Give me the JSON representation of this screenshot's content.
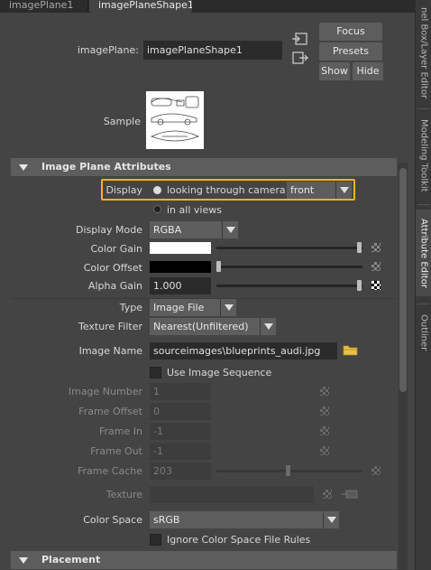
{
  "tabs": [
    "imagePlane1",
    "imagePlaneShape1"
  ],
  "side_tabs": [
    "nel Box/Layer Editor",
    "Modeling Toolkit",
    "Attribute Editor",
    "Outliner"
  ],
  "header": {
    "node_label": "imagePlane:",
    "node_value": "imagePlaneShape1",
    "focus": "Focus",
    "presets": "Presets",
    "show": "Show",
    "hide": "Hide",
    "sample_label": "Sample"
  },
  "section1": {
    "title": "Image Plane Attributes",
    "display_label": "Display",
    "display_opt1": "looking through camera",
    "display_camera": "front",
    "display_opt2": "in all views",
    "display_mode_label": "Display Mode",
    "display_mode": "RGBA",
    "color_gain_label": "Color Gain",
    "color_offset_label": "Color Offset",
    "alpha_gain_label": "Alpha Gain",
    "alpha_gain": "1.000",
    "type_label": "Type",
    "type": "Image File",
    "texture_filter_label": "Texture Filter",
    "texture_filter": "Nearest(Unfiltered)",
    "image_name_label": "Image Name",
    "image_name": "sourceimages\\blueprints_audi.jpg",
    "use_sequence": "Use Image Sequence",
    "image_number_label": "Image Number",
    "image_number": "1",
    "frame_offset_label": "Frame Offset",
    "frame_offset": "0",
    "frame_in_label": "Frame In",
    "frame_in": "-1",
    "frame_out_label": "Frame Out",
    "frame_out": "-1",
    "frame_cache_label": "Frame Cache",
    "frame_cache": "203",
    "texture_label": "Texture",
    "color_space_label": "Color Space",
    "color_space": "sRGB",
    "ignore_cs": "Ignore Color Space File Rules"
  },
  "section2": {
    "title": "Placement"
  },
  "colors": {
    "highlight": "#f0b225",
    "color_gain": "#ffffff",
    "color_offset": "#000000"
  },
  "icons": [
    "input-connection-icon",
    "output-connection-icon",
    "folder-icon",
    "map-icon",
    "checker-icon"
  ]
}
